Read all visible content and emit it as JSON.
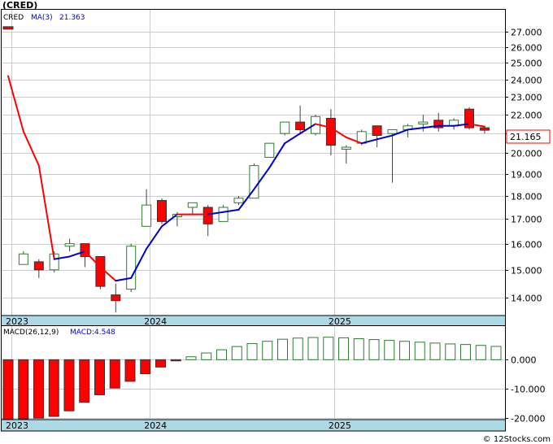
{
  "price_panel": {
    "title": "(CRED)",
    "legend_symbol": "CRED",
    "legend_ma_label": "MA(3)",
    "legend_ma_value": "21.363",
    "current_price_label": "21.165"
  },
  "macd_panel": {
    "legend_label": "MACD(26,12,9)",
    "legend_value_label": "MACD:4.548"
  },
  "watermark": "© 12Stocks.com",
  "colors": {
    "up_candle": "#2e7d32",
    "down_candle": "#ff0000",
    "ma_up": "#0000cc",
    "ma_down": "#ff0000",
    "macd_positive": "#2e7d32",
    "macd_negative": "#ff0000",
    "axis_band": "#add8e6",
    "grid": "#cccccc"
  },
  "chart_data": [
    {
      "type": "candlestick",
      "title": "(CRED)",
      "y_scale": "log",
      "ylim": [
        13.4,
        28.5
      ],
      "y_ticks": [
        14,
        15,
        16,
        17,
        18,
        19,
        20,
        21,
        22,
        23,
        24,
        25,
        26,
        27
      ],
      "y_tick_labels": [
        "14.000",
        "15.000",
        "16.000",
        "17.000",
        "18.000",
        "19.000",
        "20.000",
        "21.000",
        "22.000",
        "23.000",
        "24.000",
        "25.000",
        "26.000",
        "27.000"
      ],
      "x_labels": [
        "2023",
        "2024",
        "2025"
      ],
      "x_label_index": [
        0,
        9,
        21
      ],
      "series": [
        {
          "name": "CRED",
          "ohlc": [
            [
              27.3,
              27.3,
              27.2,
              27.2
            ],
            [
              15.2,
              15.7,
              15.2,
              15.6
            ],
            [
              15.3,
              15.4,
              14.7,
              15.0
            ],
            [
              15.0,
              15.7,
              14.9,
              15.6
            ],
            [
              15.9,
              16.2,
              15.7,
              16.0
            ],
            [
              16.0,
              16.0,
              15.1,
              15.5
            ],
            [
              15.5,
              15.5,
              14.3,
              14.4
            ],
            [
              14.1,
              14.5,
              13.5,
              13.9
            ],
            [
              14.3,
              16.0,
              14.2,
              15.9
            ],
            [
              16.7,
              18.3,
              16.7,
              17.6
            ],
            [
              17.8,
              17.9,
              16.8,
              16.9
            ],
            [
              17.1,
              17.3,
              16.7,
              17.2
            ],
            [
              17.5,
              17.7,
              17.2,
              17.7
            ],
            [
              17.5,
              17.6,
              16.3,
              16.8
            ],
            [
              16.9,
              17.6,
              16.9,
              17.5
            ],
            [
              17.7,
              18.0,
              17.6,
              17.9
            ],
            [
              17.9,
              19.5,
              17.9,
              19.4
            ],
            [
              19.8,
              20.5,
              19.8,
              20.5
            ],
            [
              21.0,
              21.6,
              20.9,
              21.6
            ],
            [
              21.6,
              22.5,
              21.0,
              21.2
            ],
            [
              21.0,
              22.0,
              20.9,
              21.9
            ],
            [
              21.8,
              22.3,
              19.9,
              20.4
            ],
            [
              20.2,
              20.4,
              19.5,
              20.3
            ],
            [
              20.5,
              21.2,
              20.4,
              21.1
            ],
            [
              21.4,
              21.4,
              20.3,
              20.9
            ],
            [
              21.0,
              21.2,
              18.6,
              21.2
            ],
            [
              21.2,
              21.5,
              20.8,
              21.4
            ],
            [
              21.5,
              22.0,
              21.1,
              21.6
            ],
            [
              21.7,
              22.1,
              21.1,
              21.3
            ],
            [
              21.4,
              21.8,
              21.2,
              21.7
            ],
            [
              22.3,
              22.4,
              21.2,
              21.3
            ],
            [
              21.3,
              21.3,
              21.0,
              21.17
            ]
          ]
        },
        {
          "name": "MA(3)",
          "values": [
            24.2,
            21.1,
            19.4,
            15.4,
            15.5,
            15.7,
            15.1,
            14.6,
            14.7,
            15.8,
            16.7,
            17.2,
            17.2,
            17.2,
            17.3,
            17.4,
            18.3,
            19.3,
            20.5,
            21.0,
            21.5,
            21.3,
            20.8,
            20.5,
            20.7,
            20.9,
            21.2,
            21.3,
            21.4,
            21.4,
            21.5,
            21.363
          ],
          "direction": [
            "down",
            "down",
            "down",
            "down",
            "up",
            "up",
            "down",
            "down",
            "up",
            "up",
            "up",
            "up",
            "down",
            "down",
            "up",
            "up",
            "up",
            "up",
            "up",
            "up",
            "up",
            "down",
            "down",
            "down",
            "up",
            "up",
            "up",
            "up",
            "up",
            "up",
            "up",
            "down"
          ]
        }
      ]
    },
    {
      "type": "bar",
      "title": "MACD(26,12,9)",
      "ylim": [
        -20.5,
        11.5
      ],
      "y_ticks": [
        -20,
        -10,
        0
      ],
      "y_tick_labels": [
        "-20.000",
        "-10.000",
        "0.000"
      ],
      "x_labels": [
        "2023",
        "2024",
        "2025"
      ],
      "x_label_index": [
        0,
        9,
        21
      ],
      "series": [
        {
          "name": "MACD",
          "values": [
            -20.3,
            -20.2,
            -20.0,
            -19.4,
            -17.5,
            -14.6,
            -12.0,
            -9.7,
            -7.4,
            -4.8,
            -2.5,
            -0.4,
            1.0,
            2.3,
            3.4,
            4.5,
            5.5,
            6.3,
            7.0,
            7.4,
            7.6,
            7.7,
            7.5,
            7.2,
            6.9,
            6.6,
            6.3,
            6.0,
            5.7,
            5.4,
            5.2,
            4.9,
            4.548
          ]
        }
      ]
    }
  ]
}
